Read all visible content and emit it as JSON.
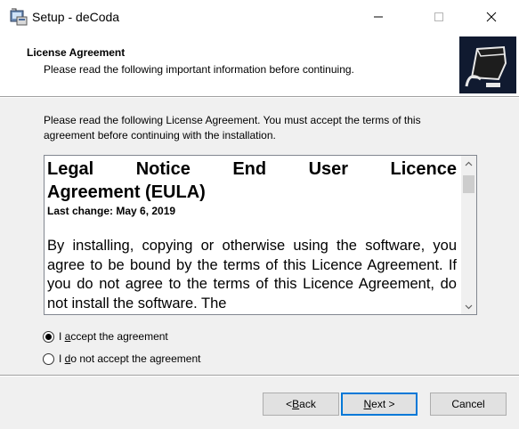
{
  "window": {
    "title": "Setup - deCoda",
    "minimize_icon": "minimize-icon",
    "maximize_icon": "maximize-icon",
    "close_icon": "close-icon"
  },
  "header": {
    "title": "License Agreement",
    "subtitle": "Please read the following important information before continuing."
  },
  "intro": "Please read the following License Agreement. You must accept the terms of this agreement before continuing with the installation.",
  "eula": {
    "heading_line1_words": [
      "Legal",
      "Notice",
      "End",
      "User",
      "Licence"
    ],
    "heading_line2": "Agreement (EULA)",
    "last_change": "Last change: May 6, 2019",
    "body": "By installing, copying or otherwise using the software, you agree to be bound by the terms of this Licence Agreement. If you do not agree to the terms of this Licence Agreement, do not install the software. The"
  },
  "options": {
    "accept": {
      "pre": "I ",
      "key": "a",
      "post": "ccept the agreement",
      "checked": true
    },
    "decline": {
      "pre": "I ",
      "key": "d",
      "post": "o not accept the agreement",
      "checked": false
    }
  },
  "buttons": {
    "back": {
      "pre": "< ",
      "key": "B",
      "post": "ack"
    },
    "next": {
      "pre": "",
      "key": "N",
      "post": "ext >"
    },
    "cancel": "Cancel"
  },
  "colors": {
    "focus_border": "#0078d7",
    "button_face": "#e1e1e1",
    "dialog_bg": "#f0f0f0"
  }
}
